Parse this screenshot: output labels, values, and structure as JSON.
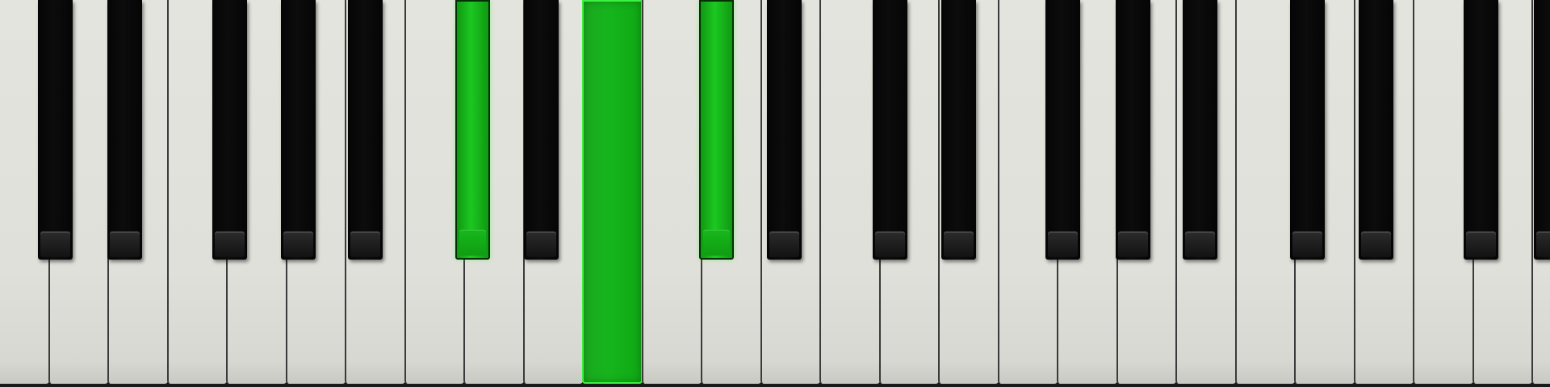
{
  "keyboard": {
    "pressed_white_keys": [
      10
    ],
    "pressed_black_keys": [
      5,
      7
    ],
    "colors": {
      "white_key": "#e2e2dc",
      "black_key": "#0a0a0a",
      "pressed_key": "#16b51c",
      "pressed_outline": "#3af23f"
    }
  }
}
